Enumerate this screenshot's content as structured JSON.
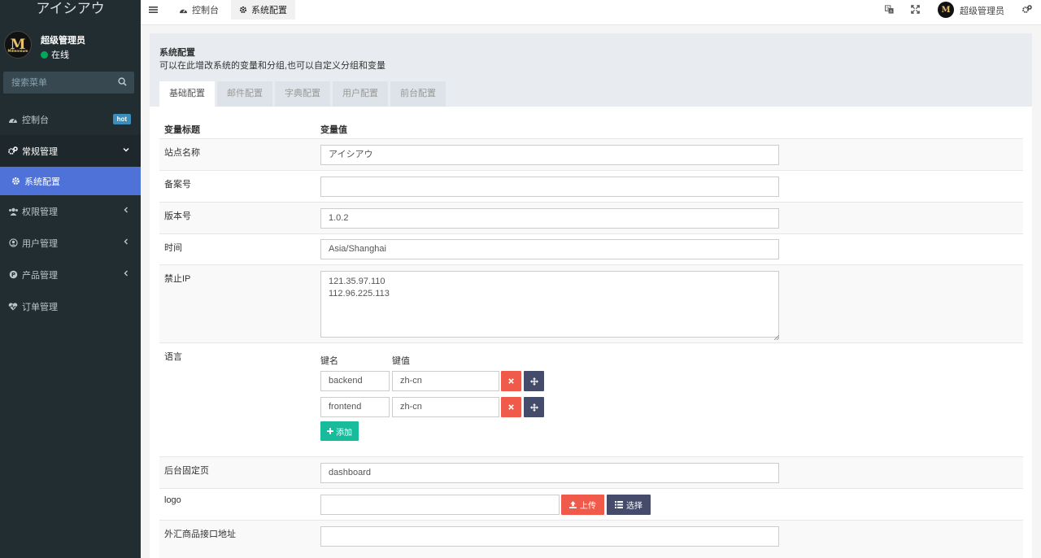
{
  "sidebar": {
    "brand": "アイシアウ",
    "avatar_letter": "M",
    "avatar_caption": "Millennium",
    "username": "超级管理员",
    "status": "在线",
    "search_placeholder": "搜索菜单",
    "items": [
      {
        "label": "控制台",
        "badge": "hot"
      },
      {
        "label": "常规管理"
      },
      {
        "label": "系统配置"
      },
      {
        "label": "权限管理"
      },
      {
        "label": "用户管理"
      },
      {
        "label": "产品管理"
      },
      {
        "label": "订单管理"
      }
    ]
  },
  "topbar": {
    "tabs": [
      {
        "label": "控制台"
      },
      {
        "label": "系统配置"
      }
    ],
    "avatar_letter": "M",
    "username": "超级管理员"
  },
  "panel": {
    "title": "系统配置",
    "description": "可以在此增改系统的变量和分组,也可以自定义分组和变量",
    "tabs": [
      "基础配置",
      "邮件配置",
      "字典配置",
      "用户配置",
      "前台配置"
    ]
  },
  "table": {
    "col_title": "变量标题",
    "col_value": "变量值",
    "rows": {
      "site_name": {
        "label": "站点名称",
        "value": "アイシアウ"
      },
      "icp": {
        "label": "备案号",
        "value": ""
      },
      "version": {
        "label": "版本号",
        "value": "1.0.2"
      },
      "timezone": {
        "label": "时间",
        "value": "Asia/Shanghai"
      },
      "forbidden_ip": {
        "label": "禁止IP",
        "value": "121.35.97.110\n112.96.225.113"
      },
      "language": {
        "label": "语言",
        "key_header": "键名",
        "value_header": "键值",
        "entries": [
          {
            "key": "backend",
            "value": "zh-cn"
          },
          {
            "key": "frontend",
            "value": "zh-cn"
          }
        ],
        "add_label": "添加"
      },
      "fixed_page": {
        "label": "后台固定页",
        "value": "dashboard"
      },
      "logo": {
        "label": "logo",
        "value": "",
        "upload_label": "上传",
        "choose_label": "选择"
      },
      "forex_api": {
        "label": "外汇商品接口地址",
        "value": ""
      }
    }
  },
  "colors": {
    "sidebar_bg": "#222d32",
    "active_item": "#4e72d8",
    "success": "#18bc9c",
    "danger": "#f05a4a",
    "navy": "#444b6b"
  }
}
